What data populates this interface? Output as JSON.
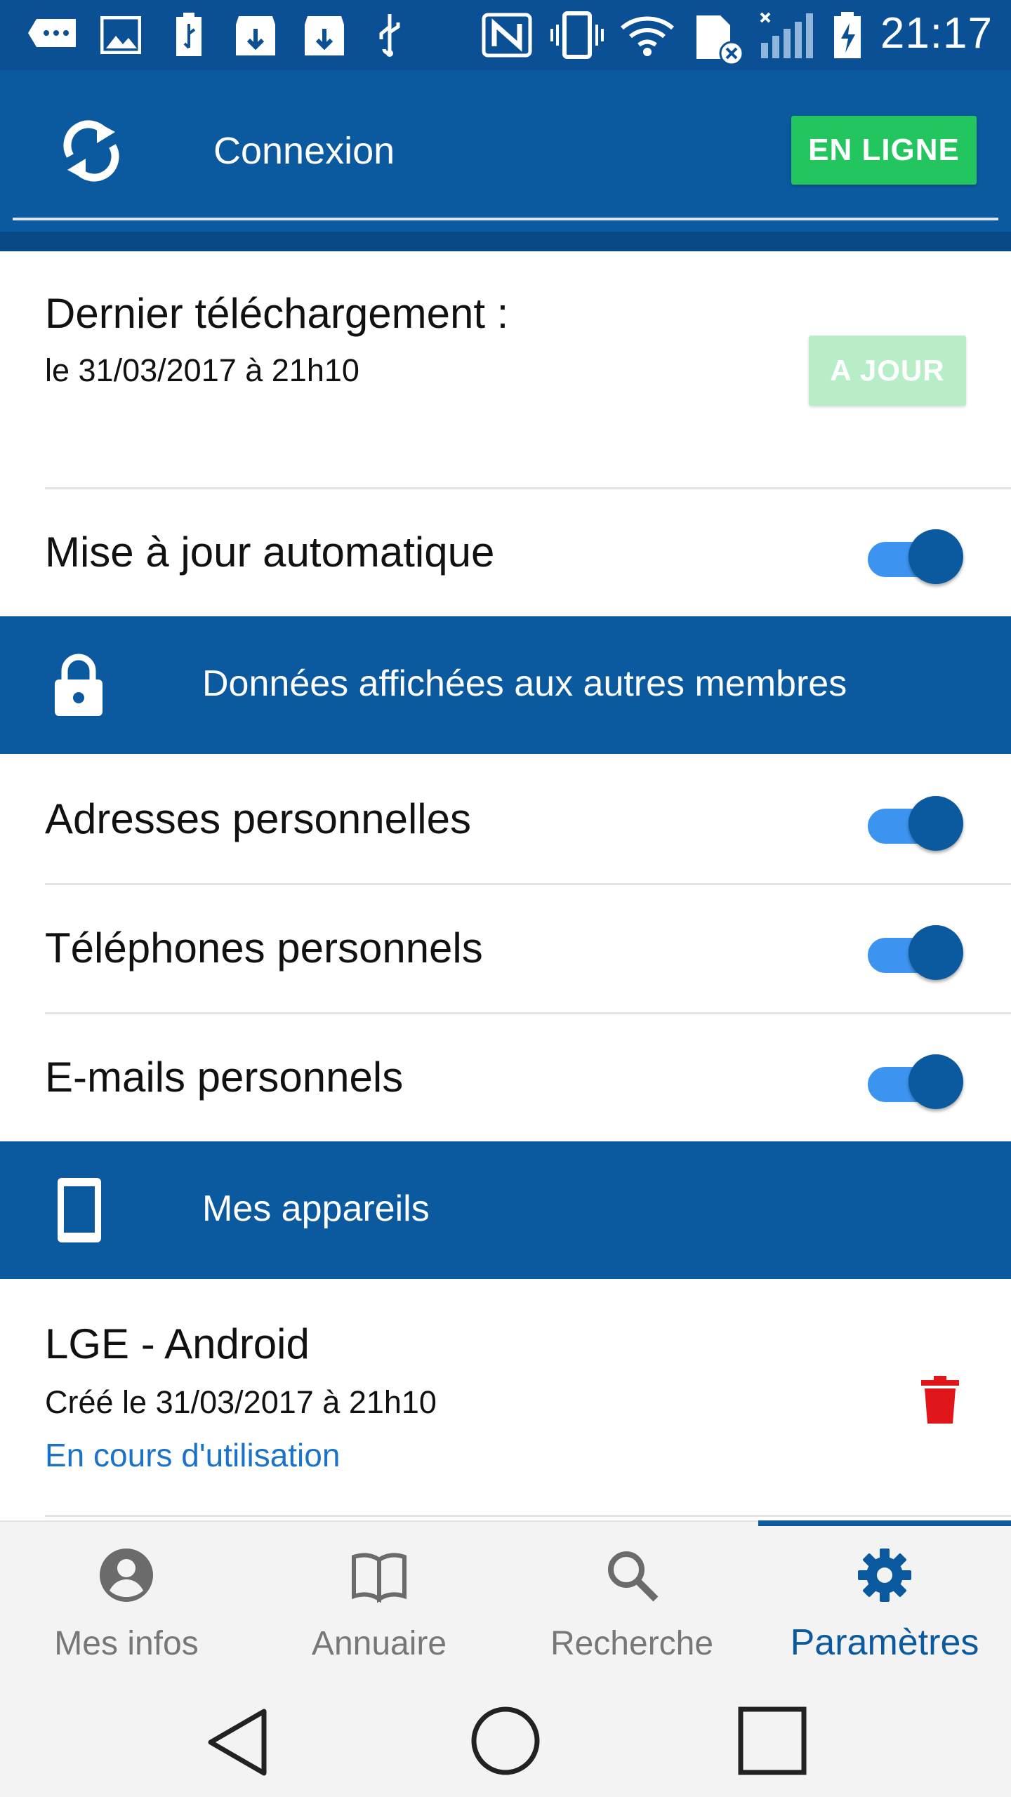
{
  "status_bar": {
    "time": "21:17",
    "icons": [
      "messaging-icon",
      "gallery-icon",
      "usb-icon",
      "download-icon",
      "download-icon",
      "usb-debug-icon",
      "nfc-icon",
      "vibrate-icon",
      "wifi-icon",
      "sim-error-icon",
      "signal-icon",
      "battery-charging-icon"
    ]
  },
  "header": {
    "title": "Connexion",
    "status_button": "EN LIGNE",
    "status_color": "#22c55e"
  },
  "download": {
    "title": "Dernier téléchargement :",
    "date": "le 31/03/2017 à 21h10",
    "status_button": "A JOUR"
  },
  "auto_update": {
    "label": "Mise à jour automatique",
    "enabled": true
  },
  "privacy_section": {
    "title": "Données affichées aux autres membres",
    "items": [
      {
        "label": "Adresses personnelles",
        "enabled": true
      },
      {
        "label": "Téléphones personnels",
        "enabled": true
      },
      {
        "label": "E-mails personnels",
        "enabled": true
      }
    ]
  },
  "devices_section": {
    "title": "Mes appareils",
    "devices": [
      {
        "name": "LGE - Android",
        "created": "Créé le 31/03/2017 à 21h10",
        "status": "En cours d'utilisation"
      }
    ]
  },
  "bottom_nav": {
    "items": [
      {
        "label": "Mes infos",
        "icon": "account-circle-icon"
      },
      {
        "label": "Annuaire",
        "icon": "book-icon"
      },
      {
        "label": "Recherche",
        "icon": "search-icon"
      },
      {
        "label": "Paramètres",
        "icon": "gear-icon"
      }
    ],
    "active_index": 3
  },
  "colors": {
    "primary": "#0b5aa0",
    "accent": "#3d94f0",
    "online_green": "#22c55e",
    "delete_red": "#e0161b",
    "link_blue": "#1a73c8"
  }
}
